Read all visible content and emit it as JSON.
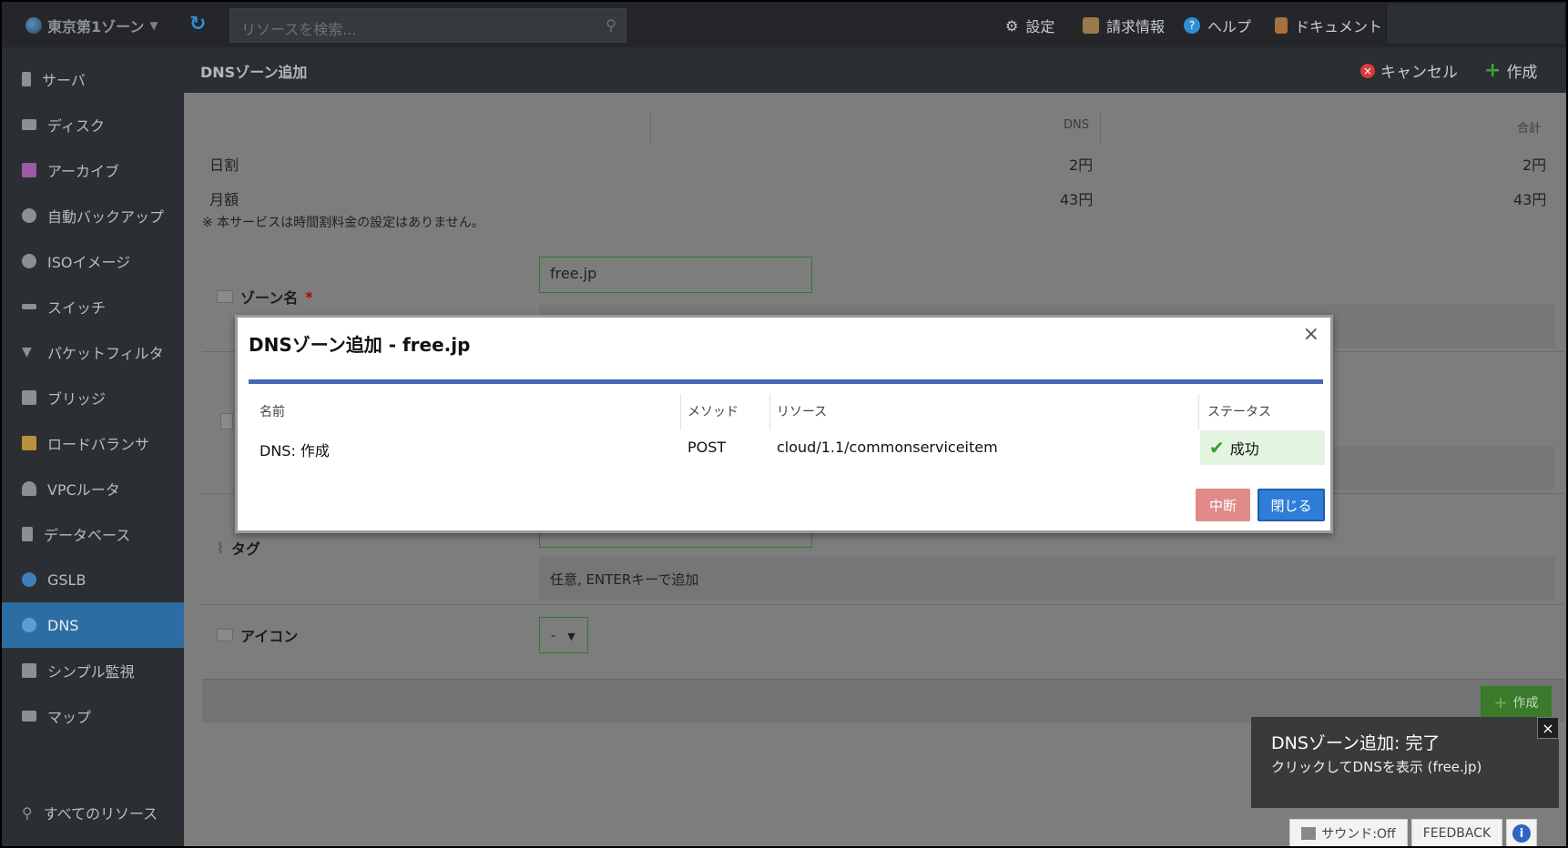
{
  "topbar": {
    "zone_label": "東京第1ゾーン",
    "search_placeholder": "リソースを検索...",
    "nav": [
      {
        "label": "設定",
        "icon": "gear-icon",
        "color": "#c8cbce"
      },
      {
        "label": "請求情報",
        "icon": "billing-icon",
        "color": "#b08a5a"
      },
      {
        "label": "ヘルプ",
        "icon": "help-icon",
        "color": "#2f8fd6"
      },
      {
        "label": "ドキュメント",
        "icon": "document-icon",
        "color": "#b07a4a"
      }
    ]
  },
  "sidebar": {
    "items": [
      {
        "label": "サーバ",
        "icon": "server-icon"
      },
      {
        "label": "ディスク",
        "icon": "disk-icon"
      },
      {
        "label": "アーカイブ",
        "icon": "archive-icon"
      },
      {
        "label": "自動バックアップ",
        "icon": "backup-icon"
      },
      {
        "label": "ISOイメージ",
        "icon": "iso-icon"
      },
      {
        "label": "スイッチ",
        "icon": "switch-icon"
      },
      {
        "label": "パケットフィルタ",
        "icon": "filter-icon"
      },
      {
        "label": "ブリッジ",
        "icon": "bridge-icon"
      },
      {
        "label": "ロードバランサ",
        "icon": "loadbalancer-icon"
      },
      {
        "label": "VPCルータ",
        "icon": "vpc-router-icon"
      },
      {
        "label": "データベース",
        "icon": "database-icon"
      },
      {
        "label": "GSLB",
        "icon": "gslb-icon"
      },
      {
        "label": "DNS",
        "icon": "dns-icon",
        "active": true
      },
      {
        "label": "シンプル監視",
        "icon": "monitor-icon"
      },
      {
        "label": "マップ",
        "icon": "map-icon"
      }
    ],
    "all_resources": "すべてのリソース"
  },
  "header": {
    "title": "DNSゾーン追加",
    "cancel_label": "キャンセル",
    "create_label": "作成"
  },
  "pricing": {
    "col_dns": "DNS",
    "col_total": "合計",
    "rows": [
      {
        "label": "日割",
        "dns": "2円",
        "total": "2円"
      },
      {
        "label": "月額",
        "dns": "43円",
        "total": "43円"
      }
    ],
    "note": "※ 本サービスは時間割料金の設定はありません。"
  },
  "form": {
    "zone_name_label": "ゾーン名",
    "required_mark": "*",
    "zone_name_value": "free.jp",
    "tag_label": "タグ",
    "tag_placeholder": "任意, ENTERキーで追加",
    "icon_label": "アイコン",
    "icon_value": "-",
    "footer_create": "作成"
  },
  "modal": {
    "title": "DNSゾーン追加 - free.jp",
    "close": "×",
    "columns": {
      "name": "名前",
      "method": "メソッド",
      "resource": "リソース",
      "status": "ステータス"
    },
    "row": {
      "name": "DNS: 作成",
      "method": "POST",
      "resource": "cloud/1.1/commonserviceitem",
      "status": "成功"
    },
    "abort_label": "中断",
    "close_label": "閉じる"
  },
  "toast": {
    "title": "DNSゾーン追加: 完了",
    "subtitle": "クリックしてDNSを表示 (free.jp)",
    "close": "×"
  },
  "bottom": {
    "sound_label": "サウンド:Off",
    "feedback_label": "FEEDBACK",
    "info_label": "i"
  }
}
